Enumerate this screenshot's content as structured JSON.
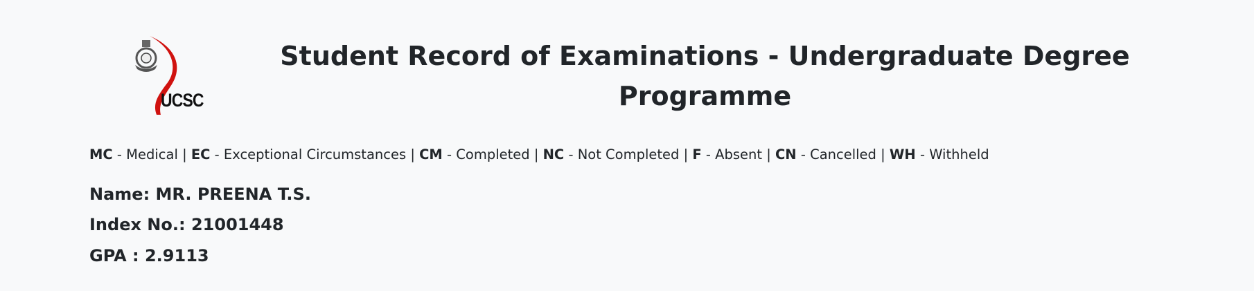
{
  "header": {
    "logo_text": "UCSC",
    "title": "Student Record of Examinations - Undergraduate Degree Programme"
  },
  "legend": [
    {
      "code": "MC",
      "meaning": "Medical"
    },
    {
      "code": "EC",
      "meaning": "Exceptional Circumstances"
    },
    {
      "code": "CM",
      "meaning": "Completed"
    },
    {
      "code": "NC",
      "meaning": "Not Completed"
    },
    {
      "code": "F",
      "meaning": "Absent"
    },
    {
      "code": "CN",
      "meaning": "Cancelled"
    },
    {
      "code": "WH",
      "meaning": "Withheld"
    }
  ],
  "student": {
    "name_label": "Name:",
    "name": "MR. PREENA T.S.",
    "index_label": "Index No.:",
    "index": "21001448",
    "gpa_label": "GPA :",
    "gpa": "2.9113"
  },
  "colors": {
    "background": "#f8f9fa",
    "text": "#212529",
    "logo_red": "#d0120f"
  }
}
